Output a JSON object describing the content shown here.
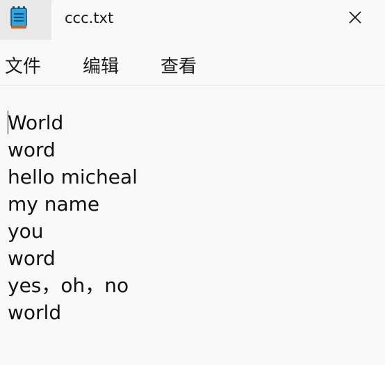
{
  "window": {
    "tab_title": "ccc.txt"
  },
  "icons": {
    "app": "notepad-icon",
    "close": "close-icon"
  },
  "colors": {
    "icon_blue": "#2aa7df",
    "icon_dark": "#124a73",
    "icon_orange": "#d1611d"
  },
  "menu": {
    "file": "文件",
    "edit": "编辑",
    "view": "查看"
  },
  "editor": {
    "lines": [
      "World",
      "word",
      "hello micheal",
      "my name",
      "you",
      "word",
      "yes，oh，no",
      "world"
    ]
  }
}
